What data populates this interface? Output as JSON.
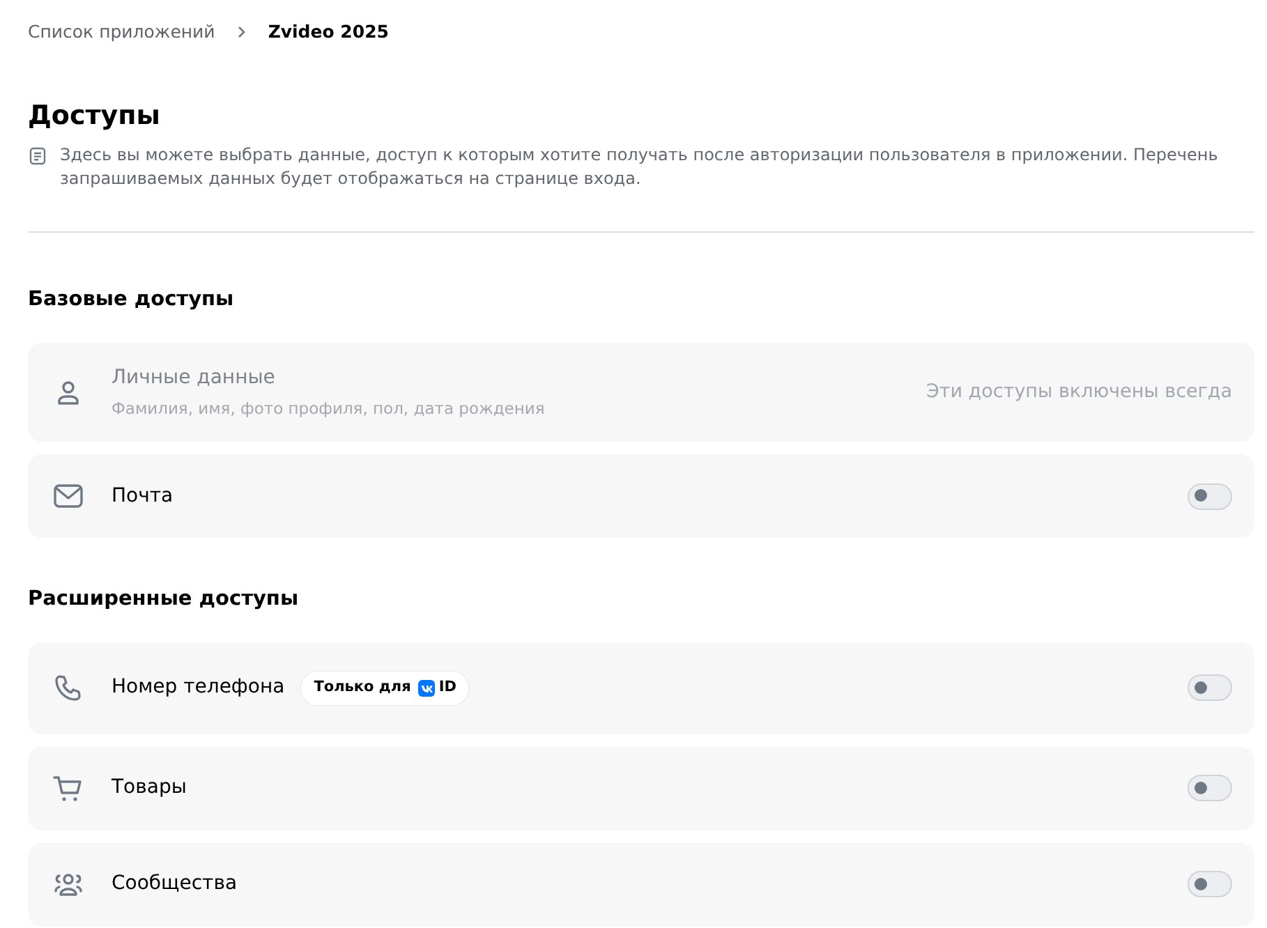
{
  "breadcrumb": [
    {
      "label": "Список приложений",
      "current": false
    },
    {
      "label": "Zvideo 2025",
      "current": true
    }
  ],
  "page": {
    "title": "Доступы",
    "description": "Здесь вы можете выбрать данные, доступ к которым хотите получать после авторизации пользователя в приложении. Перечень запрашиваемых данных будет отображаться на странице входа."
  },
  "sections": [
    {
      "title": "Базовые доступы",
      "items": [
        {
          "kind": "fixed",
          "label": "Личные данные",
          "sublabel": "Фамилия, имя, фото профиля, пол, дата рождения",
          "note": "Эти доступы включены всегда"
        },
        {
          "kind": "toggle",
          "label": "Почта",
          "on": false
        }
      ]
    },
    {
      "title": "Расширенные доступы",
      "items": [
        {
          "kind": "toggle",
          "label": "Номер телефона",
          "badge": {
            "text": "Только для",
            "suffix": "ID"
          },
          "on": false
        },
        {
          "kind": "toggle",
          "label": "Товары",
          "on": false
        },
        {
          "kind": "toggle",
          "label": "Сообщества",
          "on": false
        }
      ]
    }
  ]
}
